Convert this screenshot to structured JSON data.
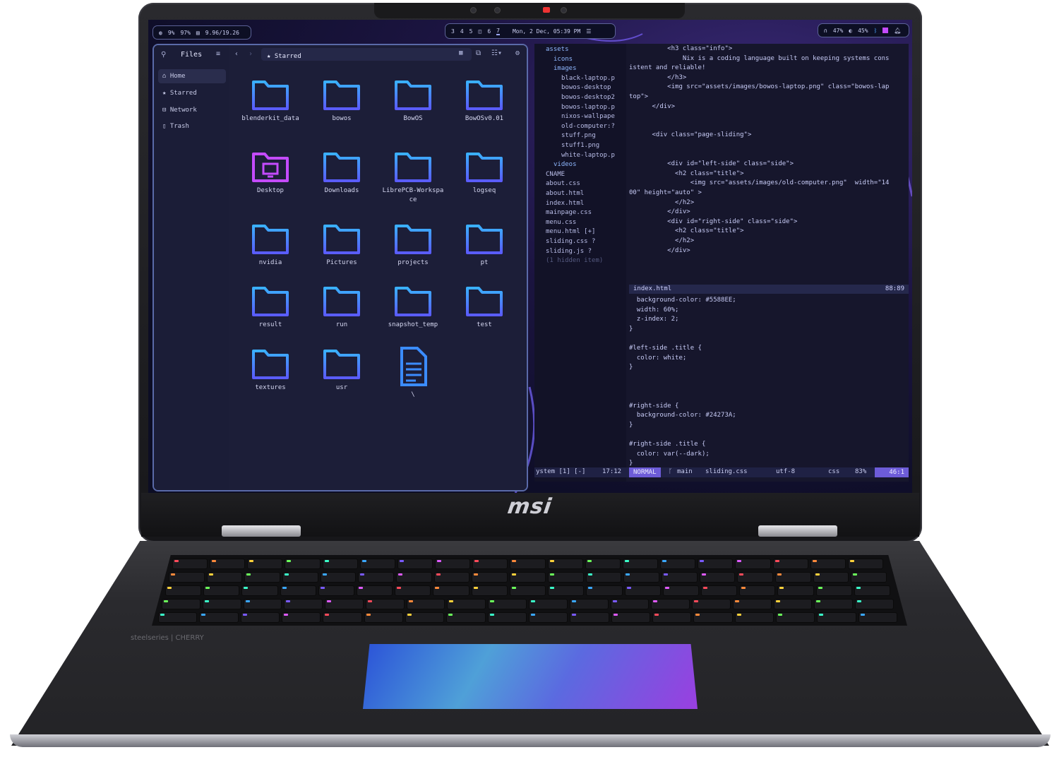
{
  "topbar": {
    "left": {
      "cpu": "9%",
      "mem": "97%",
      "disk": "9.96/19.26"
    },
    "workspaces": [
      "3",
      "4",
      "5",
      "6",
      "7"
    ],
    "active_workspace": "7",
    "clock": "Mon,  2 Dec, 05:39 PM",
    "right": {
      "headset": "47%",
      "brightness": "45%"
    }
  },
  "files": {
    "app_title": "Files",
    "location": "Starred",
    "sidebar": [
      "Home",
      "Starred",
      "Network",
      "Trash"
    ],
    "items": [
      {
        "label": "blenderkit_data",
        "icon": "folder-icon"
      },
      {
        "label": "bowos",
        "icon": "folder-icon"
      },
      {
        "label": "BowOS",
        "icon": "folder-icon"
      },
      {
        "label": "BowOSv0.01",
        "icon": "folder-icon"
      },
      {
        "label": "Desktop",
        "icon": "desktop-folder-icon"
      },
      {
        "label": "Downloads",
        "icon": "folder-icon"
      },
      {
        "label": "LibrePCB-Workspace",
        "icon": "folder-icon"
      },
      {
        "label": "logseq",
        "icon": "folder-icon"
      },
      {
        "label": "nvidia",
        "icon": "folder-icon"
      },
      {
        "label": "Pictures",
        "icon": "folder-icon"
      },
      {
        "label": "projects",
        "icon": "folder-icon"
      },
      {
        "label": "pt",
        "icon": "folder-icon"
      },
      {
        "label": "result",
        "icon": "folder-icon"
      },
      {
        "label": "run",
        "icon": "folder-icon"
      },
      {
        "label": "snapshot_temp",
        "icon": "folder-icon"
      },
      {
        "label": "test",
        "icon": "folder-icon"
      },
      {
        "label": "textures",
        "icon": "folder-icon"
      },
      {
        "label": "usr",
        "icon": "folder-icon"
      },
      {
        "label": "\\",
        "icon": "document-icon"
      }
    ]
  },
  "editor": {
    "tree": [
      {
        "name": "assets",
        "indent": 0
      },
      {
        "name": "icons",
        "indent": 1
      },
      {
        "name": "images",
        "indent": 1
      },
      {
        "name": "black-laptop.p",
        "indent": 2
      },
      {
        "name": "bowos-desktop",
        "indent": 2
      },
      {
        "name": "bowos-desktop2",
        "indent": 2
      },
      {
        "name": "bowos-laptop.p",
        "indent": 2
      },
      {
        "name": "nixos-wallpape",
        "indent": 2
      },
      {
        "name": "old-computer:?",
        "indent": 2
      },
      {
        "name": "stuff.png",
        "indent": 2
      },
      {
        "name": "stuff1.png",
        "indent": 2
      },
      {
        "name": "white-laptop.p",
        "indent": 2
      },
      {
        "name": "videos",
        "indent": 1
      },
      {
        "name": "CNAME",
        "indent": 0
      },
      {
        "name": "about.css",
        "indent": 0
      },
      {
        "name": "about.html",
        "indent": 0
      },
      {
        "name": "index.html",
        "indent": 0
      },
      {
        "name": "mainpage.css",
        "indent": 0
      },
      {
        "name": "menu.css",
        "indent": 0
      },
      {
        "name": "menu.html       [+]",
        "indent": 0
      },
      {
        "name": "sliding.css       ?",
        "indent": 0
      },
      {
        "name": "sliding.js        ?",
        "indent": 0
      },
      {
        "name": "(1 hidden item)",
        "indent": 0
      }
    ],
    "code_top": [
      "          <h3 class=\"info\">",
      "              Nix is a coding language built on keeping systems cons",
      "istent and reliable!",
      "          </h3>",
      "          <img src=\"assets/images/bowos-laptop.png\" class=\"bowos-lap",
      "top\">",
      "      </div>",
      "",
      "",
      "      <div class=\"page-sliding\">",
      "",
      "",
      "          <div id=\"left-side\" class=\"side\">",
      "            <h2 class=\"title\">",
      "                <img src=\"assets/images/old-computer.png\"  width=\"14",
      "00\" height=\"auto\" >",
      "            </h2>",
      "          </div>",
      "          <div id=\"right-side\" class=\"side\">",
      "            <h2 class=\"title\">",
      "            </h2>",
      "          </div>"
    ],
    "split_title": "index.html",
    "split_pos": "88:89",
    "code_bottom": [
      "  background-color: #5588EE;",
      "  width: 60%;",
      "  z-index: 2;",
      "}",
      "",
      "#left-side .title {",
      "  color: white;",
      "}",
      "",
      "",
      "",
      "#right-side {",
      "  background-color: #24273A;",
      "}",
      "",
      "#right-side .title {",
      "  color: var(--dark);",
      "}"
    ],
    "status": {
      "left": "ystem [1] [-]",
      "time": "17:12",
      "mode": "NORMAL",
      "branch": "main",
      "file": "sliding.css",
      "encoding": "utf-8",
      "filetype": "css",
      "percent": "83%",
      "position": "46:1"
    }
  },
  "hardware": {
    "brand": "msi",
    "keyboard_brand": "steelseries | CHERRY"
  },
  "colors": {
    "accent": "#5a6aa8",
    "folder": "#3b8cff",
    "folder_alt": "#c44bff",
    "touchpad": "#5b6ae0"
  }
}
